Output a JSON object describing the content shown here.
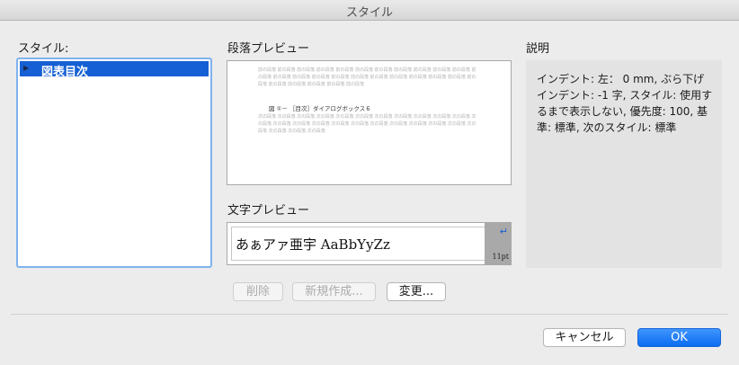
{
  "window": {
    "title": "スタイル"
  },
  "labels": {
    "style": "スタイル:",
    "paragraph_preview": "段落プレビュー",
    "description": "説明",
    "char_preview": "文字プレビュー"
  },
  "style_list": {
    "items": [
      {
        "name": "図表目次",
        "selected": true
      }
    ]
  },
  "paragraph_preview": {
    "filler_before": "前の段落 前の段落 前の段落 前の段落 前の段落 前の段落 前の段落 前の段落 前の段落 前の段落 前の段落 前の段落 前の段落 前の段落 前の段落 前の段落 前の段落 前の段落 前の段落 前の段落 前の段落 前の段落 前の段落 前の段落 前の段落 前の段落 前の段落 前の段落",
    "sample": "図 ①－ ［目次］ダイアログボックス６",
    "filler_after": "次の段落 次の段落 次の段落 次の段落 次の段落 次の段落 次の段落 次の段落 次の段落 次の段落 次の段落 次の段落 次の段落 次の段落 次の段落 次の段落 次の段落 次の段落 次の段落 次の段落 次の段落 次の段落 次の段落 次の段落 次の段落 次の段落"
  },
  "char_preview": {
    "text": "あぁアァ亜宇 AaBbYyZz",
    "size": "11pt",
    "return_icon": "return-arrow-icon"
  },
  "description": {
    "text": "インデント: 左： 0 mm, ぶら下げインデント: -1 字, スタイル: 使用するまで表示しない, 優先度: 100, 基準: 標準, 次のスタイル: 標準"
  },
  "buttons": {
    "delete": "削除",
    "new": "新規作成...",
    "modify": "変更...",
    "cancel": "キャンセル",
    "ok": "OK"
  },
  "colors": {
    "selection": "#1560d4",
    "accent": "#0b6cf0"
  }
}
